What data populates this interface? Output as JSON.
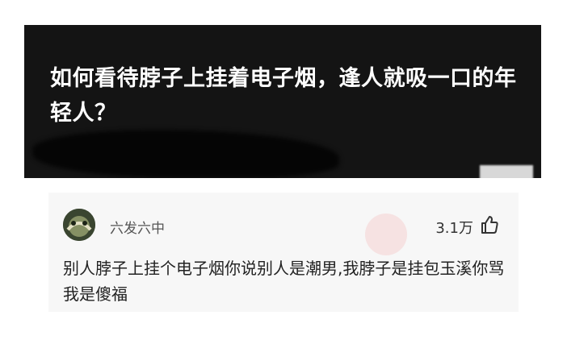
{
  "question": {
    "title": "如何看待脖子上挂着电子烟，逢人就吸一口的年轻人？"
  },
  "answer": {
    "author": "六发六中",
    "likes": "3.1万",
    "content": "别人脖子上挂个电子烟你说别人是潮男,我脖子是挂包玉溪你骂我是傻福"
  },
  "icons": {
    "like": "thumbs-up-icon",
    "avatar": "avatar"
  },
  "colors": {
    "header_bg": "#141414",
    "card_bg": "#f7f7f7",
    "title_text": "#ffffff"
  }
}
